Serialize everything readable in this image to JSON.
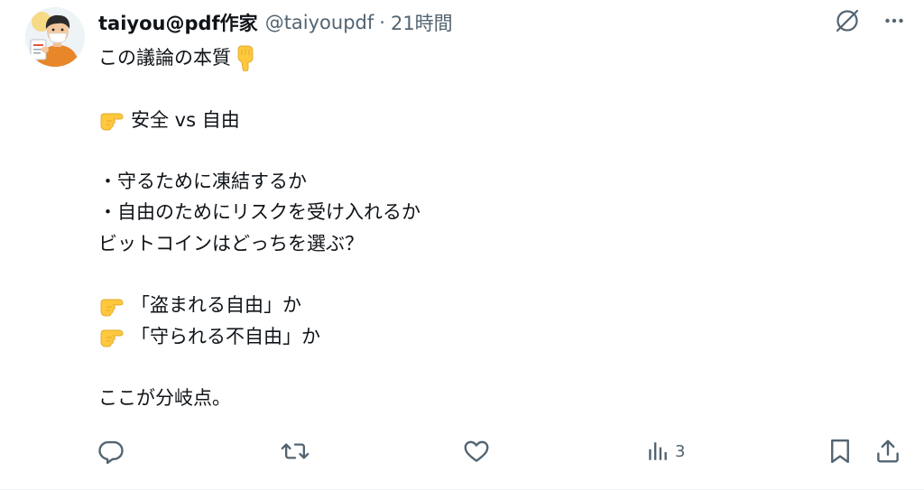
{
  "tweet": {
    "author": {
      "display_name": "taiyou@pdf作家",
      "handle": "@taiyoupdf",
      "separator": "·",
      "time_ago": "21時間",
      "avatar_icon": "person-with-document-avatar"
    },
    "top_actions": {
      "grok_icon": "grok-slash-circle-icon",
      "more_icon": "more-horizontal-icon"
    },
    "lines": [
      {
        "emoji": "",
        "text": "この議論の本質",
        "emoji_right": "pointing-down-emoji"
      },
      {
        "emoji": "",
        "text": "",
        "emoji_right": ""
      },
      {
        "emoji": "pointing-right-emoji",
        "text": "安全 vs 自由",
        "emoji_right": ""
      },
      {
        "emoji": "",
        "text": "",
        "emoji_right": ""
      },
      {
        "emoji": "",
        "text": "・守るために凍結するか",
        "emoji_right": ""
      },
      {
        "emoji": "",
        "text": "・自由のためにリスクを受け入れるか",
        "emoji_right": ""
      },
      {
        "emoji": "",
        "text": "ビットコインはどっちを選ぶ？",
        "emoji_right": ""
      },
      {
        "emoji": "",
        "text": "",
        "emoji_right": ""
      },
      {
        "emoji": "pointing-right-emoji",
        "text": "「盗まれる自由」か",
        "emoji_right": ""
      },
      {
        "emoji": "pointing-right-emoji",
        "text": "「守られる不自由」か",
        "emoji_right": ""
      },
      {
        "emoji": "",
        "text": "",
        "emoji_right": ""
      },
      {
        "emoji": "",
        "text": "ここが分岐点。",
        "emoji_right": ""
      }
    ],
    "actions": {
      "reply_icon": "reply-icon",
      "retweet_icon": "retweet-icon",
      "like_icon": "like-heart-icon",
      "views_icon": "views-bar-chart-icon",
      "views_count": "3",
      "bookmark_icon": "bookmark-icon",
      "share_icon": "share-upload-icon"
    }
  },
  "colors": {
    "text_primary": "#0f1419",
    "text_secondary": "#536471",
    "emoji_yellow": "#FFC83D",
    "emoji_shadow": "#E0A830"
  }
}
